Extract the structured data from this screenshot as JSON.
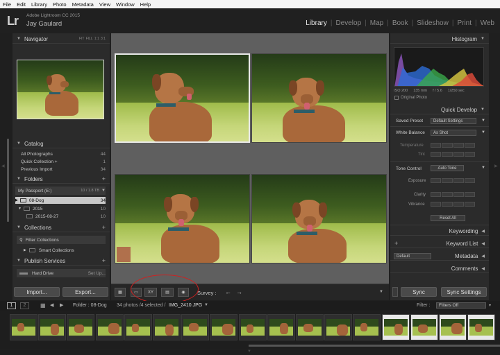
{
  "menu": [
    "File",
    "Edit",
    "Library",
    "Photo",
    "Metadata",
    "View",
    "Window",
    "Help"
  ],
  "identity": {
    "logo": "Lr",
    "app": "Adobe Lightroom CC 2015",
    "user": "Jay Gaulard"
  },
  "modules": [
    "Library",
    "Develop",
    "Map",
    "Book",
    "Slideshow",
    "Print",
    "Web"
  ],
  "navigator": {
    "title": "Navigator",
    "zoom": [
      "FIT",
      "FILL",
      "1:1",
      "3:1"
    ]
  },
  "catalog": {
    "title": "Catalog",
    "items": [
      {
        "label": "All Photographs",
        "count": "44"
      },
      {
        "label": "Quick Collection +",
        "count": "1"
      },
      {
        "label": "Previous Import",
        "count": "34"
      }
    ]
  },
  "folders": {
    "title": "Folders",
    "volume": "My Passport (E:)",
    "volume_info": "10 / 1.8 TB",
    "items": [
      {
        "label": "08-Dog",
        "count": "34"
      },
      {
        "label": "2015",
        "count": "10"
      },
      {
        "label": "2015-08-27",
        "count": "10"
      }
    ]
  },
  "collections": {
    "title": "Collections",
    "filter": "Filter Collections",
    "smart": "Smart Collections"
  },
  "publish": {
    "title": "Publish Services",
    "hard_drive": "Hard Drive",
    "setup": "Set Up..."
  },
  "buttons": {
    "import": "Import...",
    "export": "Export...",
    "sync": "Sync",
    "sync_settings": "Sync Settings",
    "reset_all": "Reset All"
  },
  "toolbar": {
    "survey": "Survey :"
  },
  "filmbar": {
    "page1": "1",
    "page2": "2",
    "folder": "Folder : 08-Dog",
    "info": "34 photos /4 selected /",
    "filename": "IMG_2410.JPG",
    "filter_label": "Filter :",
    "filter_value": "Filters Off"
  },
  "right": {
    "histogram": "Histogram",
    "exif": [
      "ISO 200",
      "135 mm",
      "f / 5.6",
      "1/250 sec"
    ],
    "original_photo": "Original Photo",
    "quick_develop": "Quick Develop",
    "saved_preset_label": "Saved Preset",
    "saved_preset_value": "Default Settings",
    "white_balance_label": "White Balance",
    "white_balance_value": "As Shot",
    "temperature": "Temperature",
    "tint": "Tint",
    "tone_control": "Tone Control",
    "auto_tone": "Auto Tone",
    "exposure": "Exposure",
    "clarity": "Clarity",
    "vibrance": "Vibrance",
    "keywording": "Keywording",
    "keyword_list": "Keyword List",
    "metadata": "Metadata",
    "metadata_preset": "Default",
    "comments": "Comments"
  }
}
